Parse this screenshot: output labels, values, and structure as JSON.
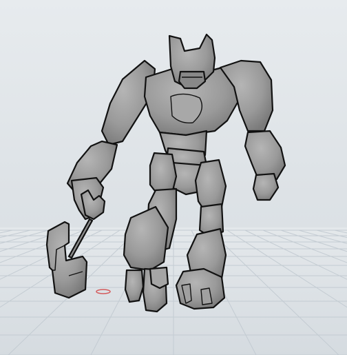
{
  "viewport": {
    "background_top": "#e7ebee",
    "background_bottom": "#d7dde2",
    "grid_color": "#c3cbd2",
    "model_fill": "#9a9a9a",
    "model_outline": "#111111",
    "origin_marker_color": "#d23a3a"
  },
  "scene": {
    "model_name": "stone-golem-with-hammer",
    "ground_grid": "on"
  }
}
